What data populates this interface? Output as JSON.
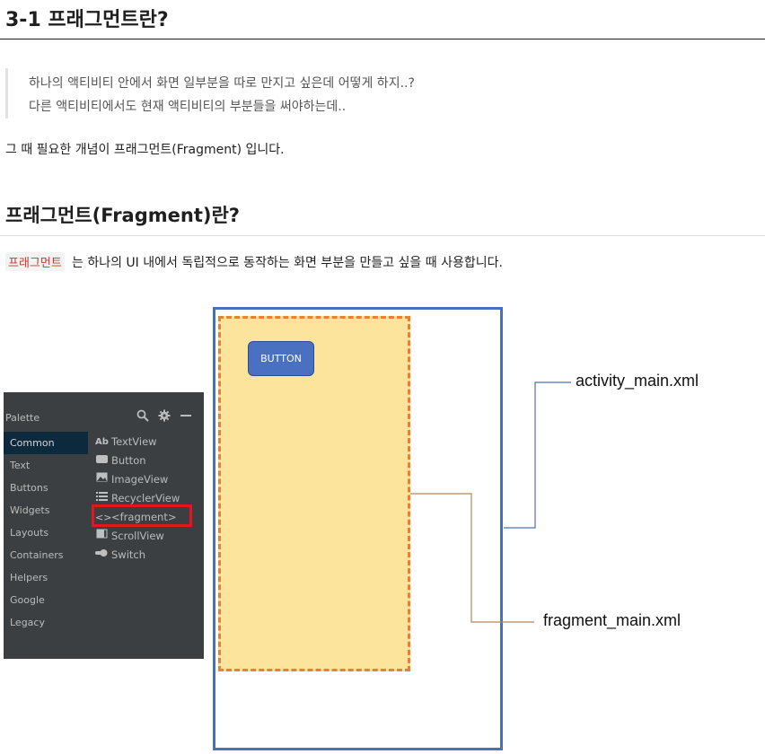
{
  "section": {
    "title": "3-1 프래그먼트란?",
    "quote_lines": [
      "하나의 액티비티 안에서 화면 일부분을 따로 만지고 싶은데 어떻게 하지..?",
      "다른 액티비티에서도 현재 액티비티의 부분들을 써야하는데.."
    ],
    "paragraph": "그 때 필요한 개념이 프래그먼트(Fragment) 입니다."
  },
  "subsection": {
    "title": "프래그먼트(Fragment)란?",
    "code_term": "프래그먼트",
    "paragraph": "는 하나의 UI 내에서 독립적으로 동작하는 화면 부분을 만들고 싶을 때 사용합니다."
  },
  "palette": {
    "title": "Palette",
    "tool_icons": [
      "search-icon",
      "gear-icon",
      "minimize-icon"
    ],
    "categories": [
      "Common",
      "Text",
      "Buttons",
      "Widgets",
      "Layouts",
      "Containers",
      "Helpers",
      "Google",
      "Legacy"
    ],
    "selected_category": "Common",
    "items": [
      {
        "icon": "Ab",
        "label": "TextView"
      },
      {
        "icon": "button-icon",
        "label": "Button"
      },
      {
        "icon": "image-icon",
        "label": "ImageView"
      },
      {
        "icon": "list-icon",
        "label": "RecyclerView"
      },
      {
        "icon": "<>",
        "label": "<fragment>"
      },
      {
        "icon": "scroll-icon",
        "label": "ScrollView"
      },
      {
        "icon": "switch-icon",
        "label": "Switch"
      }
    ],
    "highlight_color": "#e3161f"
  },
  "diagram": {
    "button_label": "BUTTON",
    "activity_label": "activity_main.xml",
    "fragment_label": "fragment_main.xml",
    "colors": {
      "activity_border": "#4a70b9",
      "fragment_fill": "#fde49d",
      "fragment_border": "#e9822e",
      "button_fill": "#4a70c2",
      "activity_leader": "#4a70b9",
      "fragment_leader": "#b5865a"
    }
  }
}
